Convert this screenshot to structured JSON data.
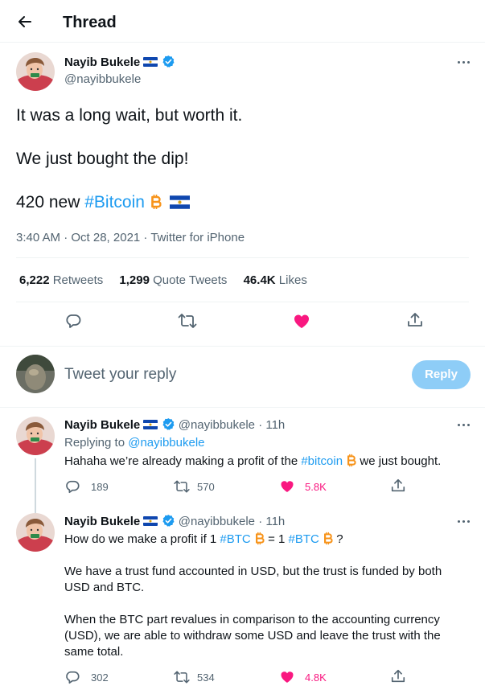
{
  "header": {
    "title": "Thread"
  },
  "main_tweet": {
    "name": "Nayib Bukele",
    "handle": "@nayibbukele",
    "line1": "It was a long wait, but worth it.",
    "line2": "We just bought the dip!",
    "line3_prefix": "420 new ",
    "line3_hashtag": "#Bitcoin",
    "meta": "3:40 AM · Oct 28, 2021 · Twitter for iPhone",
    "retweets_count": "6,222",
    "retweets_label": "Retweets",
    "quotes_count": "1,299",
    "quotes_label": "Quote Tweets",
    "likes_count": "46.4K",
    "likes_label": "Likes"
  },
  "reply_box": {
    "placeholder": "Tweet your reply",
    "button": "Reply"
  },
  "replies": [
    {
      "name": "Nayib Bukele",
      "handle": "@nayibbukele",
      "time": "· 11h",
      "replying_prefix": "Replying to ",
      "replying_handle": "@nayibbukele",
      "text_before": "Hahaha we’re already making a profit of the ",
      "hashtag": "#bitcoin",
      "text_after": " we just bought.",
      "replies": "189",
      "retweets": "570",
      "likes": "5.8K"
    },
    {
      "name": "Nayib Bukele",
      "handle": "@nayibbukele",
      "time": "· 11h",
      "q_prefix": "How do we make a profit if 1 ",
      "q_hashtag1": "#BTC",
      "q_mid": " = 1 ",
      "q_hashtag2": "#BTC",
      "q_end": " ?",
      "para1": "We have a trust fund accounted in USD, but the trust is funded by both USD and BTC.",
      "para2": "When the BTC part revalues in comparison to the accounting currency (USD), we are able to withdraw some USD and leave the trust with the same total.",
      "replies": "302",
      "retweets": "534",
      "likes": "4.8K"
    }
  ],
  "colors": {
    "accent": "#1d9bf0",
    "like": "#f91880",
    "bitcoin": "#f7931a",
    "text": "#0f1419",
    "secondary": "#536471"
  }
}
